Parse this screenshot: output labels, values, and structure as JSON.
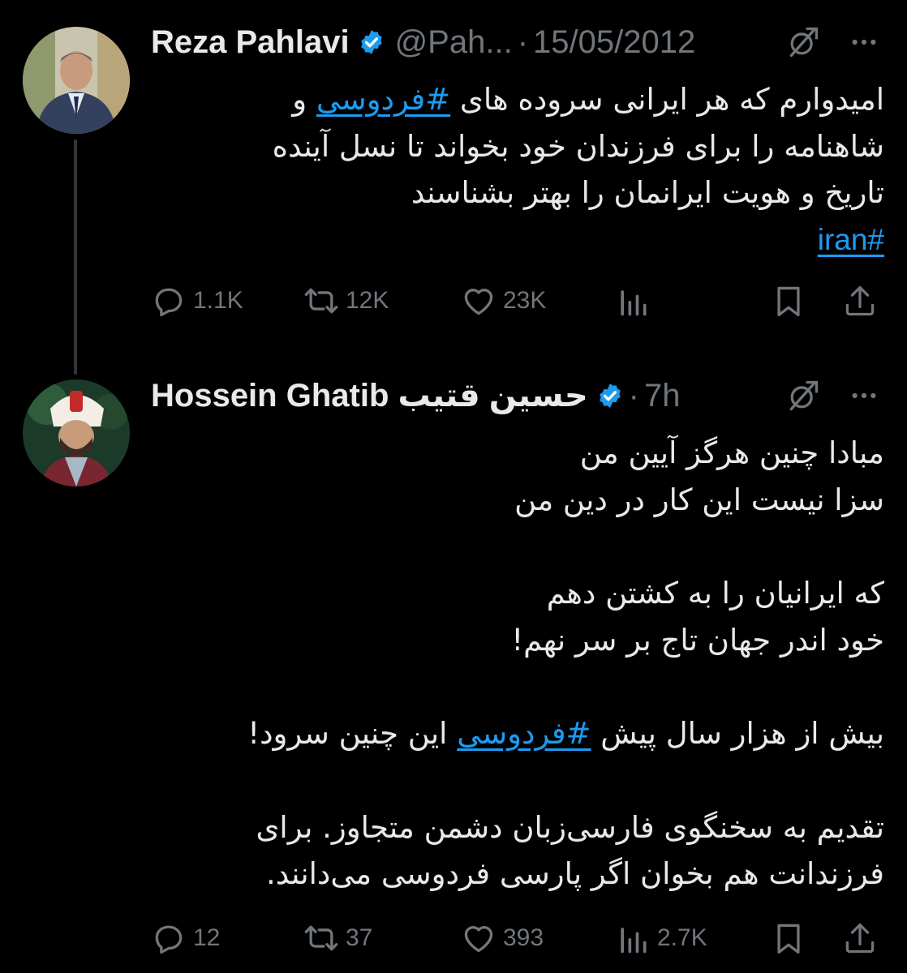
{
  "tweets": [
    {
      "name": "Reza Pahlavi",
      "handle": "@Pah...",
      "separator": "·",
      "date": "15/05/2012",
      "verified": true,
      "body_lines": [
        "امیدوارم که هر ایرانی سروده های |#فردوسی| و",
        "شاهنامه را برای فرزندان خود بخواند تا نسل آینده",
        "تاریخ و هویت ایرانمان را بهتر بشناسند"
      ],
      "body_line1_before": "امیدوارم که هر ایرانی سروده های ",
      "body_line1_hashtag": "#فردوسی",
      "body_line1_after": " و",
      "body_line2": "شاهنامه را برای فرزندان خود بخواند تا نسل آینده",
      "body_line3": "تاریخ و هویت ایرانمان را بهتر بشناسند",
      "hashtag_iran": "#iran",
      "replies": "1.1K",
      "retweets": "12K",
      "likes": "23K",
      "views": ""
    },
    {
      "name": "Hossein Ghatib حسین قتیب",
      "separator": "·",
      "date": "7h",
      "verified": true,
      "line1": "مبادا چنین هرگز آیین من",
      "line2": "سزا نیست این کار در دین من",
      "line3": "که ایرانیان را به کشتن دهم",
      "line4": "خود اندر جهان تاج بر سر نهم!",
      "line5_before": "بیش از هزار سال پیش ",
      "line5_hashtag": "#فردوسی",
      "line5_after": " این چنین سرود!",
      "line6": "تقدیم به سخنگوی فارسی‌زبان دشمن متجاوز. برای",
      "line7": "فرزندانت هم بخوان اگر پارسی فردوسی می‌دانند.",
      "replies": "12",
      "retweets": "37",
      "likes": "393",
      "views": "2.7K"
    }
  ],
  "colors": {
    "background": "#000000",
    "text": "#e7e9ea",
    "muted": "#71767b",
    "link": "#1d9bf0",
    "verified": "#1d9bf0",
    "thread_line": "#333639"
  },
  "icons": [
    "verified-badge-icon",
    "grok-icon",
    "more-icon",
    "reply-icon",
    "retweet-icon",
    "like-icon",
    "views-icon",
    "bookmark-icon",
    "share-icon"
  ]
}
